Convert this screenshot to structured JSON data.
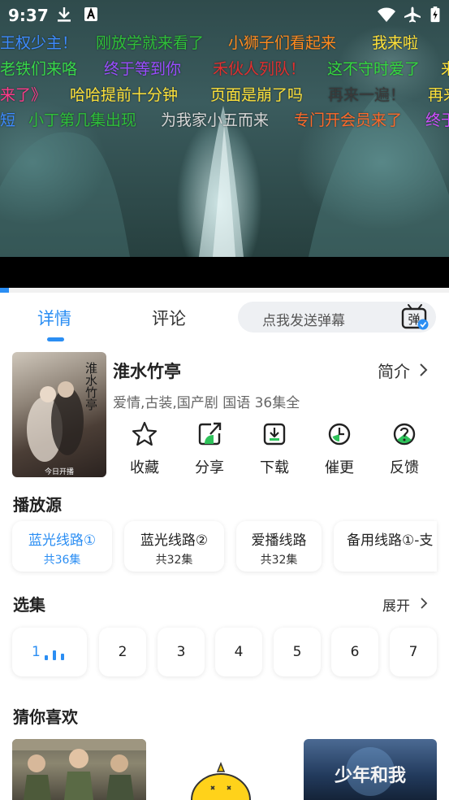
{
  "status_bar": {
    "time": "9:37",
    "icons": [
      "download-icon",
      "a-notification-icon",
      "wifi-icon",
      "airplane-mode-icon",
      "battery-charging-icon"
    ]
  },
  "player": {
    "progress_fraction": 0.02,
    "danmaku": [
      {
        "text": "王权少主！",
        "color": "#3d8bff"
      },
      {
        "text": "刚放学就来看了",
        "color": "#2fbf3a"
      },
      {
        "text": "小狮子们看起来",
        "color": "#ff8a1f"
      },
      {
        "text": "我来啦",
        "color": "#ffe23a"
      },
      {
        "text": "老铁们来咯",
        "color": "#38d84a"
      },
      {
        "text": "终于等到你",
        "color": "#9b4dff"
      },
      {
        "text": "禾伙人列队！",
        "color": "#e03030"
      },
      {
        "text": "这不守时爱了",
        "color": "#35d940"
      },
      {
        "text": "来",
        "color": "#ffe23a"
      },
      {
        "text": "来了》",
        "color": "#ff3b8a"
      },
      {
        "text": "哈哈提前十分钟",
        "color": "#ffe23a"
      },
      {
        "text": "页面是崩了吗",
        "color": "#ffe23a"
      },
      {
        "text": "再来一遍！",
        "color": "#3a3a3a"
      },
      {
        "text": "再来",
        "color": "#ffe23a"
      },
      {
        "text": "短",
        "color": "#3d8bff"
      },
      {
        "text": "小丁第几集出现",
        "color": "#2fbf3a"
      },
      {
        "text": "为我家小五而来",
        "color": "#d8d8d8"
      },
      {
        "text": "专门开会员来了",
        "color": "#ff6a2a"
      },
      {
        "text": "终于",
        "color": "#d04dff"
      }
    ]
  },
  "tabs": {
    "detail": "详情",
    "comments": "评论",
    "active": "详情"
  },
  "danmaku_input": {
    "placeholder": "点我发送弹幕",
    "toggle_icon": "danmaku-toggle-icon",
    "toggle_glyph": "弹"
  },
  "show": {
    "title": "淮水竹亭",
    "synopsis_label": "简介",
    "meta": "爱情,古装,国产剧 国语 36集全",
    "poster_text": "淮水竹亭",
    "poster_caption": "今日开播"
  },
  "actions": [
    {
      "label": "收藏",
      "icon": "star-icon"
    },
    {
      "label": "分享",
      "icon": "share-icon"
    },
    {
      "label": "下载",
      "icon": "download-icon"
    },
    {
      "label": "催更",
      "icon": "clock-icon"
    },
    {
      "label": "反馈",
      "icon": "question-icon"
    }
  ],
  "sources": {
    "title": "播放源",
    "items": [
      {
        "name": "蓝光线路①",
        "count": "共36集",
        "active": true
      },
      {
        "name": "蓝光线路②",
        "count": "共32集",
        "active": false
      },
      {
        "name": "爱播线路",
        "count": "共32集",
        "active": false
      },
      {
        "name": "备用线路①-支",
        "count": "",
        "active": false
      }
    ]
  },
  "episodes": {
    "title": "选集",
    "expand_label": "展开",
    "items": [
      "1",
      "2",
      "3",
      "4",
      "5",
      "6",
      "7"
    ],
    "current": "1"
  },
  "recommendations": {
    "title": "猜你喜欢",
    "items": [
      {
        "poster_text": ""
      },
      {
        "poster_text": ""
      },
      {
        "poster_text": "少年和我"
      }
    ]
  },
  "colors": {
    "accent": "#2b8ef3",
    "icon_green": "#2ec25a",
    "text": "#222222",
    "muted": "#666666"
  }
}
